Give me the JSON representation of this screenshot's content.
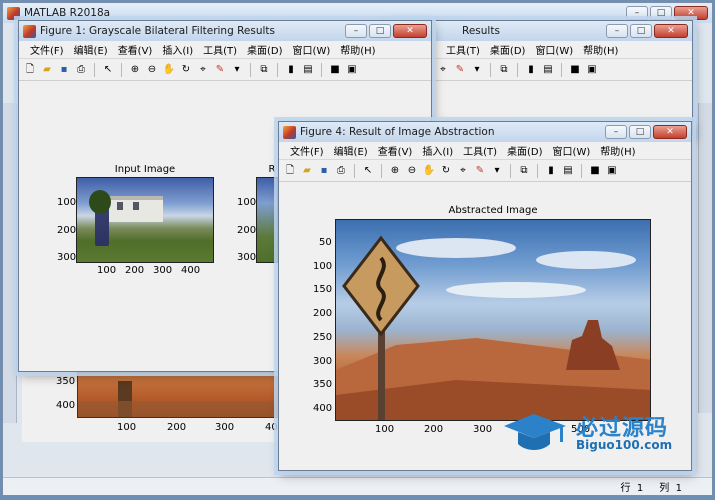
{
  "main_window": {
    "title": "MATLAB R2018a",
    "status": {
      "row_label": "行",
      "row_value": "1",
      "col_label": "列",
      "col_value": "1"
    }
  },
  "partial_fig_title": "Results",
  "menu": [
    "文件(F)",
    "编辑(E)",
    "查看(V)",
    "插入(I)",
    "工具(T)",
    "桌面(D)",
    "窗口(W)",
    "帮助(H)"
  ],
  "fig1": {
    "title": "Figure 1: Grayscale Bilateral Filtering Results",
    "axes_title": "Input Image",
    "second_axes_title_partial": "R",
    "yticks": [
      "100",
      "200",
      "300"
    ],
    "xticks": [
      "100",
      "200",
      "300",
      "400"
    ]
  },
  "fig4": {
    "title": "Figure 4: Result of Image Abstraction",
    "axes_title": "Abstracted Image",
    "yticks": [
      "50",
      "100",
      "150",
      "200",
      "250",
      "300",
      "350",
      "400"
    ],
    "xticks": [
      "100",
      "200",
      "300",
      "400",
      "500"
    ]
  },
  "behind_fig": {
    "yticks": [
      "350",
      "400"
    ],
    "xticks": [
      "100",
      "200",
      "300",
      "400"
    ]
  },
  "watermark": {
    "text": "必过源码",
    "sub": "Biguo100.com"
  },
  "colors": {
    "accent": "#2b82c9",
    "close": "#c4402e"
  }
}
